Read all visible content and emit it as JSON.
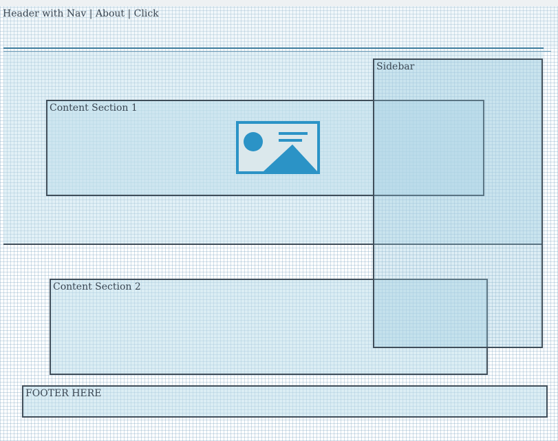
{
  "header": {
    "text": "Header with Nav | About | Click"
  },
  "sidebar": {
    "label": "Sidebar"
  },
  "content_sections": [
    {
      "label": "Content Section 1",
      "has_image_placeholder": true
    },
    {
      "label": "Content Section 2",
      "has_image_placeholder": false
    }
  ],
  "footer": {
    "text": "FOOTER HERE"
  },
  "icons": {
    "image_placeholder": "image-placeholder-icon"
  },
  "colors": {
    "block_fill": "#cde4ee",
    "border": "#3f4d59",
    "accent": "#2b93c6",
    "grid_line": "#78a0be"
  }
}
